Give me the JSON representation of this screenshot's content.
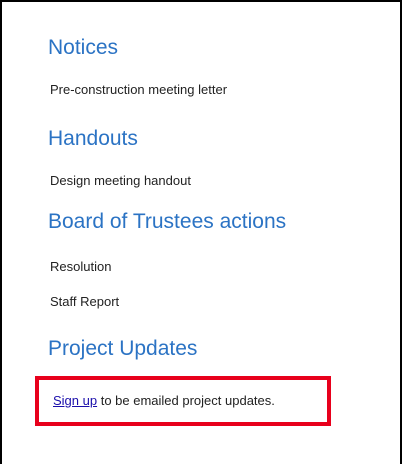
{
  "sections": [
    {
      "title": "Notices",
      "items": [
        "Pre-construction meeting letter"
      ]
    },
    {
      "title": "Handouts",
      "items": [
        "Design meeting handout"
      ]
    },
    {
      "title": "Board of Trustees actions",
      "items": [
        "Resolution",
        "Staff Report"
      ]
    },
    {
      "title": "Project Updates",
      "items": []
    }
  ],
  "signup": {
    "link_text": "Sign up",
    "rest_text": " to be emailed project updates."
  },
  "colors": {
    "heading": "#2b73c4",
    "highlight_box": "#e8001c",
    "link": "#1a0dab"
  }
}
